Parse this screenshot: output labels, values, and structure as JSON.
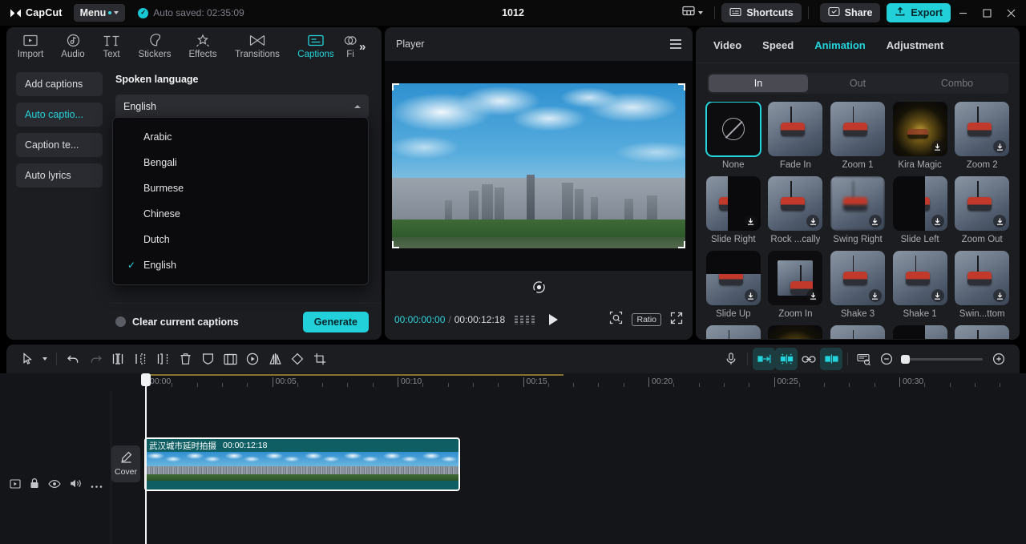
{
  "titlebar": {
    "app_name": "CapCut",
    "menu_label": "Menu",
    "autosave_text": "Auto saved: 02:35:09",
    "project_title": "1012",
    "shortcuts_label": "Shortcuts",
    "share_label": "Share",
    "export_label": "Export",
    "accent": "#21d0d8"
  },
  "left_panel": {
    "tabs": [
      {
        "label": "Import",
        "icon": "import-icon",
        "active": false
      },
      {
        "label": "Audio",
        "icon": "audio-icon",
        "active": false
      },
      {
        "label": "Text",
        "icon": "text-icon",
        "active": false
      },
      {
        "label": "Stickers",
        "icon": "stickers-icon",
        "active": false
      },
      {
        "label": "Effects",
        "icon": "effects-icon",
        "active": false
      },
      {
        "label": "Transitions",
        "icon": "transitions-icon",
        "active": false
      },
      {
        "label": "Captions",
        "icon": "captions-icon",
        "active": true
      },
      {
        "label": "Fi",
        "icon": "filters-icon",
        "active": false
      }
    ],
    "more_tabs_icon": "double-chevron-right-icon",
    "side_actions": [
      {
        "label": "Add captions",
        "active": false
      },
      {
        "label": "Auto captio...",
        "active": true
      },
      {
        "label": "Caption te...",
        "active": false
      },
      {
        "label": "Auto lyrics",
        "active": false
      }
    ],
    "section_title": "Spoken language",
    "select_value": "English",
    "dropdown_options": [
      {
        "label": "Arabic",
        "checked": false
      },
      {
        "label": "Bengali",
        "checked": false
      },
      {
        "label": "Burmese",
        "checked": false
      },
      {
        "label": "Chinese",
        "checked": false
      },
      {
        "label": "Dutch",
        "checked": false
      },
      {
        "label": "English",
        "checked": true
      }
    ],
    "clear_captions_label": "Clear current captions",
    "generate_label": "Generate"
  },
  "player": {
    "title": "Player",
    "current_time": "00:00:00:00",
    "time_separator": "/",
    "total_time": "00:00:12:18",
    "ratio_label": "Ratio",
    "reset_icon": "reset-icon",
    "play_icon": "play-icon",
    "zoom_icon": "magnifier-icon",
    "fullscreen_icon": "fullscreen-icon"
  },
  "right_panel": {
    "tabs": [
      {
        "label": "Video",
        "active": false
      },
      {
        "label": "Speed",
        "active": false
      },
      {
        "label": "Animation",
        "active": true
      },
      {
        "label": "Adjustment",
        "active": false
      }
    ],
    "segments": [
      {
        "label": "In",
        "active": true
      },
      {
        "label": "Out",
        "active": false
      },
      {
        "label": "Combo",
        "active": false
      }
    ],
    "animations": [
      {
        "label": "None",
        "kind": "none",
        "selected": true,
        "download": false
      },
      {
        "label": "Fade In",
        "kind": "gondola",
        "selected": false,
        "download": false
      },
      {
        "label": "Zoom 1",
        "kind": "gondola",
        "selected": false,
        "download": false
      },
      {
        "label": "Kira Magic",
        "kind": "sparkle",
        "selected": false,
        "download": true
      },
      {
        "label": "Zoom 2",
        "kind": "gondola",
        "selected": false,
        "download": true
      },
      {
        "label": "Slide Right",
        "kind": "half-right",
        "selected": false,
        "download": true
      },
      {
        "label": "Rock ...cally",
        "kind": "gondola",
        "selected": false,
        "download": true
      },
      {
        "label": "Swing Right",
        "kind": "blur",
        "selected": false,
        "download": true
      },
      {
        "label": "Slide Left",
        "kind": "half-left",
        "selected": false,
        "download": true
      },
      {
        "label": "Zoom Out",
        "kind": "gondola",
        "selected": false,
        "download": true
      },
      {
        "label": "Slide Up",
        "kind": "half-top",
        "selected": false,
        "download": true
      },
      {
        "label": "Zoom In",
        "kind": "inset",
        "selected": false,
        "download": true
      },
      {
        "label": "Shake 3",
        "kind": "gondola",
        "selected": false,
        "download": true
      },
      {
        "label": "Shake 1",
        "kind": "gondola",
        "selected": false,
        "download": true
      },
      {
        "label": "Swin...ttom",
        "kind": "gondola",
        "selected": false,
        "download": true
      },
      {
        "label": "",
        "kind": "gondola",
        "selected": false,
        "download": false
      },
      {
        "label": "",
        "kind": "sparkle",
        "selected": false,
        "download": false
      },
      {
        "label": "",
        "kind": "gondola",
        "selected": false,
        "download": false
      },
      {
        "label": "",
        "kind": "half-left",
        "selected": false,
        "download": false
      },
      {
        "label": "",
        "kind": "gondola",
        "selected": false,
        "download": false
      }
    ]
  },
  "timeline": {
    "tools_left": [
      {
        "name": "select-tool",
        "icon": "cursor-icon"
      },
      {
        "name": "select-dropdown",
        "icon": "chevron-down-icon"
      },
      {
        "name": "undo-button",
        "icon": "undo-icon"
      },
      {
        "name": "redo-button",
        "icon": "redo-icon"
      },
      {
        "name": "split-button",
        "icon": "split-icon"
      },
      {
        "name": "trim-left-button",
        "icon": "trim-left-icon"
      },
      {
        "name": "trim-right-button",
        "icon": "trim-right-icon"
      },
      {
        "name": "delete-button",
        "icon": "trash-icon"
      },
      {
        "name": "mask-button",
        "icon": "mask-icon"
      },
      {
        "name": "freeze-button",
        "icon": "freeze-icon"
      },
      {
        "name": "reverse-button",
        "icon": "reverse-icon"
      },
      {
        "name": "mirror-button",
        "icon": "mirror-icon"
      },
      {
        "name": "rotate-button",
        "icon": "rotate-icon"
      },
      {
        "name": "crop-button",
        "icon": "crop-icon"
      }
    ],
    "tools_right": [
      {
        "name": "record-voiceover-button",
        "icon": "microphone-icon",
        "on": false
      },
      {
        "name": "snap-to-edge-button",
        "icon": "snap-icon",
        "on": true
      },
      {
        "name": "auto-arrange-button",
        "icon": "magnet-icon",
        "on": true
      },
      {
        "name": "link-clips-button",
        "icon": "link-icon",
        "on": false
      },
      {
        "name": "center-align-button",
        "icon": "align-center-icon",
        "on": true
      },
      {
        "name": "preview-button",
        "icon": "preview-icon",
        "on": false
      },
      {
        "name": "zoom-out-button",
        "icon": "zoom-out-icon",
        "on": false
      },
      {
        "name": "zoom-in-button",
        "icon": "zoom-in-icon",
        "on": false
      }
    ],
    "ruler_labels": [
      "00:00",
      "00:05",
      "00:10",
      "00:15",
      "00:20",
      "00:25",
      "00:30"
    ],
    "track_icons": [
      {
        "name": "track-preview-toggle",
        "icon": "preview-square-icon"
      },
      {
        "name": "track-lock-toggle",
        "icon": "lock-icon"
      },
      {
        "name": "track-visibility-toggle",
        "icon": "eye-icon"
      },
      {
        "name": "track-mute-toggle",
        "icon": "speaker-icon"
      },
      {
        "name": "track-more-button",
        "icon": "ellipsis-icon"
      }
    ],
    "cover_label": "Cover",
    "clip": {
      "name": "武汉城市延时拍摄",
      "duration": "00:00:12:18"
    }
  }
}
